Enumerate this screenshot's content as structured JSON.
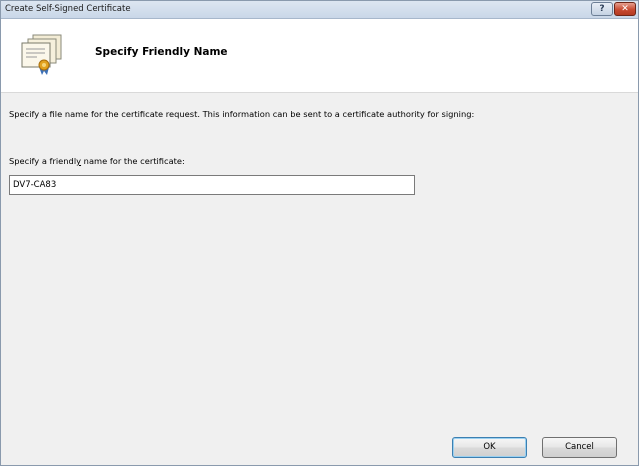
{
  "window": {
    "title": "Create Self-Signed Certificate",
    "help_label": "?",
    "close_label": "✕"
  },
  "banner": {
    "title": "Specify Friendly Name",
    "icon": "certificate-icon"
  },
  "content": {
    "description": "Specify a file name for the certificate request.  This information can be sent to a certificate authority for signing:",
    "field_label_before": "Specify a friendl",
    "field_label_accel": "y",
    "field_label_after": " name for the certificate:",
    "friendly_name_value": "DV7-CA83"
  },
  "buttons": {
    "ok_label": "OK",
    "cancel_label": "Cancel"
  },
  "colors": {
    "close_button": "#c84a31",
    "titlebar": "#c9d7e8",
    "dialog_background": "#f0f0f0"
  }
}
